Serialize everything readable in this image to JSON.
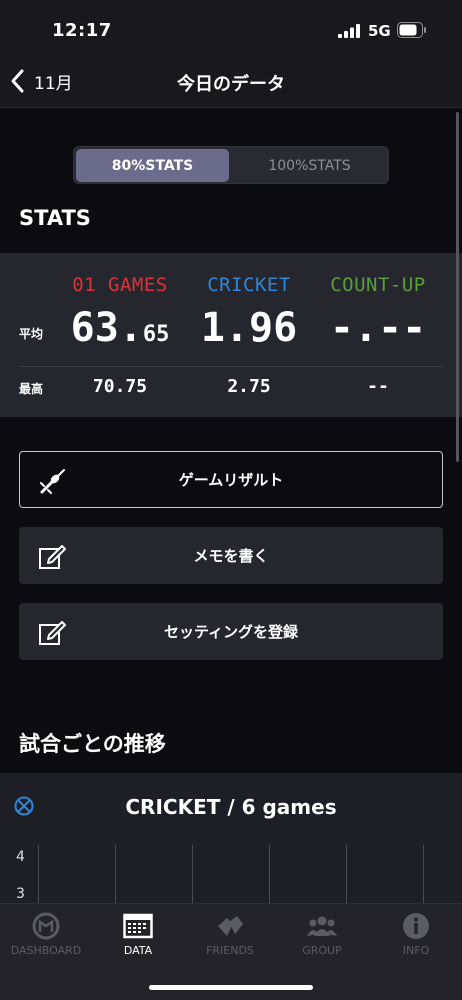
{
  "status_bar": {
    "time": "12:17",
    "network": "5G"
  },
  "nav": {
    "back_label": "11月",
    "title": "今日のデータ"
  },
  "segment": {
    "options": [
      "80%STATS",
      "100%STATS"
    ],
    "selected": "80%STATS"
  },
  "stats": {
    "title": "STATS",
    "columns": [
      {
        "name": "01 GAMES",
        "color": "#d8333a",
        "avg_int": "63.",
        "avg_dec": "65",
        "max": "70.75"
      },
      {
        "name": "CRICKET",
        "color": "#2f86d6",
        "avg_int": "1.96",
        "avg_dec": "",
        "max": "2.75"
      },
      {
        "name": "COUNT-UP",
        "color": "#5a9e3c",
        "avg_int": "-.--",
        "avg_dec": "",
        "max": "--"
      }
    ],
    "avg_label": "平均",
    "max_label": "最高"
  },
  "actions": {
    "game_result": "ゲームリザルト",
    "write_memo": "メモを書く",
    "register_setting": "セッティングを登録"
  },
  "trend": {
    "title": "試合ごとの推移",
    "chart_title": "CRICKET / 6 games"
  },
  "chart_data": {
    "type": "line",
    "title": "CRICKET / 6 games",
    "y_ticks": [
      "4",
      "3"
    ],
    "series": []
  },
  "tabs": [
    {
      "label": "DASHBOARD",
      "icon": "dashboard-icon"
    },
    {
      "label": "DATA",
      "icon": "data-icon",
      "active": true
    },
    {
      "label": "FRIENDS",
      "icon": "friends-icon"
    },
    {
      "label": "GROUP",
      "icon": "group-icon"
    },
    {
      "label": "INFO",
      "icon": "info-icon"
    }
  ]
}
